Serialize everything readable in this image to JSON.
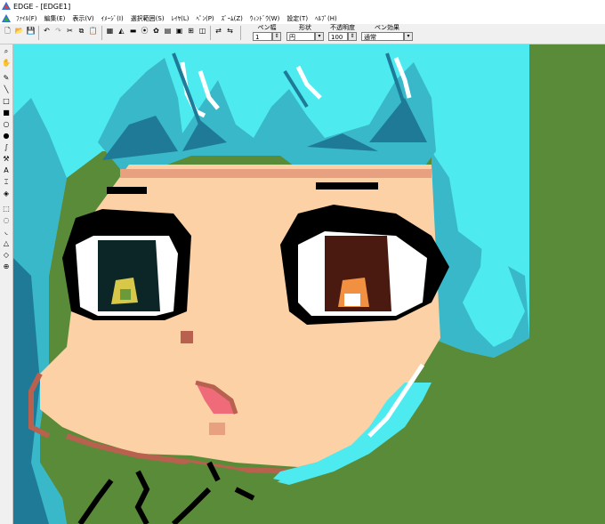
{
  "window": {
    "title": "EDGE - [EDGE1]"
  },
  "menu": [
    "ﾌｧｲﾙ(F)",
    "編集(E)",
    "表示(V)",
    "ｲﾒｰｼﾞ(I)",
    "選択範囲(S)",
    "ﾚｲﾔ(L)",
    "ﾍﾟﾝ(P)",
    "ｽﾞｰﾑ(Z)",
    "ｳｨﾝﾄﾞｳ(W)",
    "設定(T)",
    "ﾍﾙﾌﾟ(H)"
  ],
  "toolbar": {
    "pen_width_label": "ペン幅",
    "pen_width_value": "1",
    "shape_label": "形状",
    "shape_value": "円",
    "opacity_label": "不透明度",
    "opacity_value": "100",
    "pen_effect_label": "ペン効果",
    "pen_effect_value": "通常"
  },
  "palette": {
    "hair_light": "#4deaf0",
    "hair_mid": "#38b8c8",
    "hair_dark": "#1f7a98",
    "skin": "#fdd1a6",
    "skin_shadow": "#e8a180",
    "blush": "#b8614e",
    "background": "#5a8b38",
    "white": "#ffffff",
    "black": "#000000",
    "eye_left_iris": "#0c2628",
    "eye_left_highlight": "#d8c84a",
    "eye_right_iris": "#4a1a10",
    "eye_right_highlight": "#f09040",
    "mouth": "#ef6b7a"
  }
}
